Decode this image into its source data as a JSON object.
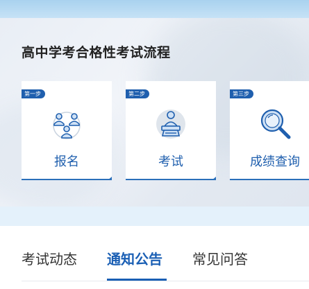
{
  "process": {
    "title": "高中学考合格性考试流程",
    "steps": [
      {
        "tag": "第一步",
        "label": "报名",
        "icon": "people-group-icon"
      },
      {
        "tag": "第二步",
        "label": "考试",
        "icon": "exam-candidate-icon"
      },
      {
        "tag": "第三步",
        "label": "成绩查询",
        "icon": "magnifier-icon"
      }
    ]
  },
  "tabs": {
    "items": [
      "考试动态",
      "通知公告",
      "常见问答"
    ],
    "active": "通知公告"
  },
  "colors": {
    "accent": "#1a5fb4",
    "tag_bg": "#1f5fae",
    "title": "#222222"
  }
}
